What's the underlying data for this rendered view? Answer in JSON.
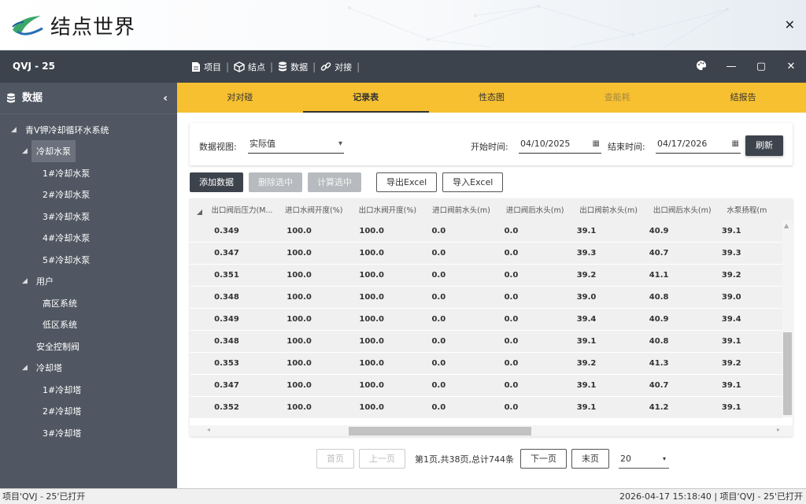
{
  "app": {
    "title": "结点世界"
  },
  "sidebar": {
    "project": "QVJ - 25",
    "section": "数据",
    "tree": [
      {
        "label": "青V钾冷却循环水系统",
        "level": 0,
        "toggle": true
      },
      {
        "label": "冷却水泵",
        "level": 1,
        "toggle": true,
        "selected": true
      },
      {
        "label": "1#冷却水泵",
        "level": 2
      },
      {
        "label": "2#冷却水泵",
        "level": 2
      },
      {
        "label": "3#冷却水泵",
        "level": 2
      },
      {
        "label": "4#冷却水泵",
        "level": 2
      },
      {
        "label": "5#冷却水泵",
        "level": 2
      },
      {
        "label": "用户",
        "level": 1,
        "toggle": true
      },
      {
        "label": "高区系统",
        "level": 2
      },
      {
        "label": "低区系统",
        "level": 2
      },
      {
        "label": "安全控制阀",
        "level": 1
      },
      {
        "label": "冷却塔",
        "level": 1,
        "toggle": true
      },
      {
        "label": "1#冷却塔",
        "level": 2
      },
      {
        "label": "2#冷却塔",
        "level": 2
      },
      {
        "label": "3#冷却塔",
        "level": 2
      }
    ]
  },
  "toolbar": {
    "project": "项目",
    "node": "结点",
    "data": "数据",
    "connect": "对接"
  },
  "tabs": [
    "对对碰",
    "记录表",
    "性态图",
    "查能耗",
    "结报告"
  ],
  "filter": {
    "view_label": "数据视图:",
    "view_value": "实际值",
    "start_label": "开始时间:",
    "start_value": "04/10/2025",
    "end_label": "结束时间:",
    "end_value": "04/17/2026",
    "refresh": "刷新"
  },
  "actions": {
    "add": "添加数据",
    "delete": "删除选中",
    "calc": "计算选中",
    "export": "导出Excel",
    "import": "导入Excel"
  },
  "table": {
    "headers": [
      "出口阀后压力(M...",
      "进口水阀开度(%)",
      "出口水阀开度(%)",
      "进口阀前水头(m)",
      "进口阀后水头(m)",
      "出口阀前水头(m)",
      "出口阀后水头(m)",
      "水泵扬程(m"
    ],
    "rows": [
      [
        "0.349",
        "100.0",
        "100.0",
        "0.0",
        "0.0",
        "39.1",
        "40.9",
        "39.1"
      ],
      [
        "0.347",
        "100.0",
        "100.0",
        "0.0",
        "0.0",
        "39.3",
        "40.7",
        "39.3"
      ],
      [
        "0.351",
        "100.0",
        "100.0",
        "0.0",
        "0.0",
        "39.2",
        "41.1",
        "39.2"
      ],
      [
        "0.348",
        "100.0",
        "100.0",
        "0.0",
        "0.0",
        "39.0",
        "40.8",
        "39.0"
      ],
      [
        "0.349",
        "100.0",
        "100.0",
        "0.0",
        "0.0",
        "39.4",
        "40.9",
        "39.4"
      ],
      [
        "0.348",
        "100.0",
        "100.0",
        "0.0",
        "0.0",
        "39.1",
        "40.8",
        "39.1"
      ],
      [
        "0.353",
        "100.0",
        "100.0",
        "0.0",
        "0.0",
        "39.2",
        "41.3",
        "39.2"
      ],
      [
        "0.347",
        "100.0",
        "100.0",
        "0.0",
        "0.0",
        "39.1",
        "40.7",
        "39.1"
      ],
      [
        "0.352",
        "100.0",
        "100.0",
        "0.0",
        "0.0",
        "39.1",
        "41.2",
        "39.1"
      ]
    ]
  },
  "pager": {
    "first": "首页",
    "prev": "上一页",
    "info": "第1页,共38页,总计744条",
    "next": "下一页",
    "last": "末页",
    "size": "20"
  },
  "status": {
    "left": "项目'QVJ - 25'已打开",
    "right": "2026-04-17 15:18:40 | 项目'QVJ - 25'已打开"
  },
  "colors": {
    "accent": "#f7c030",
    "dark": "#3d434c",
    "sidebar": "#505762"
  }
}
